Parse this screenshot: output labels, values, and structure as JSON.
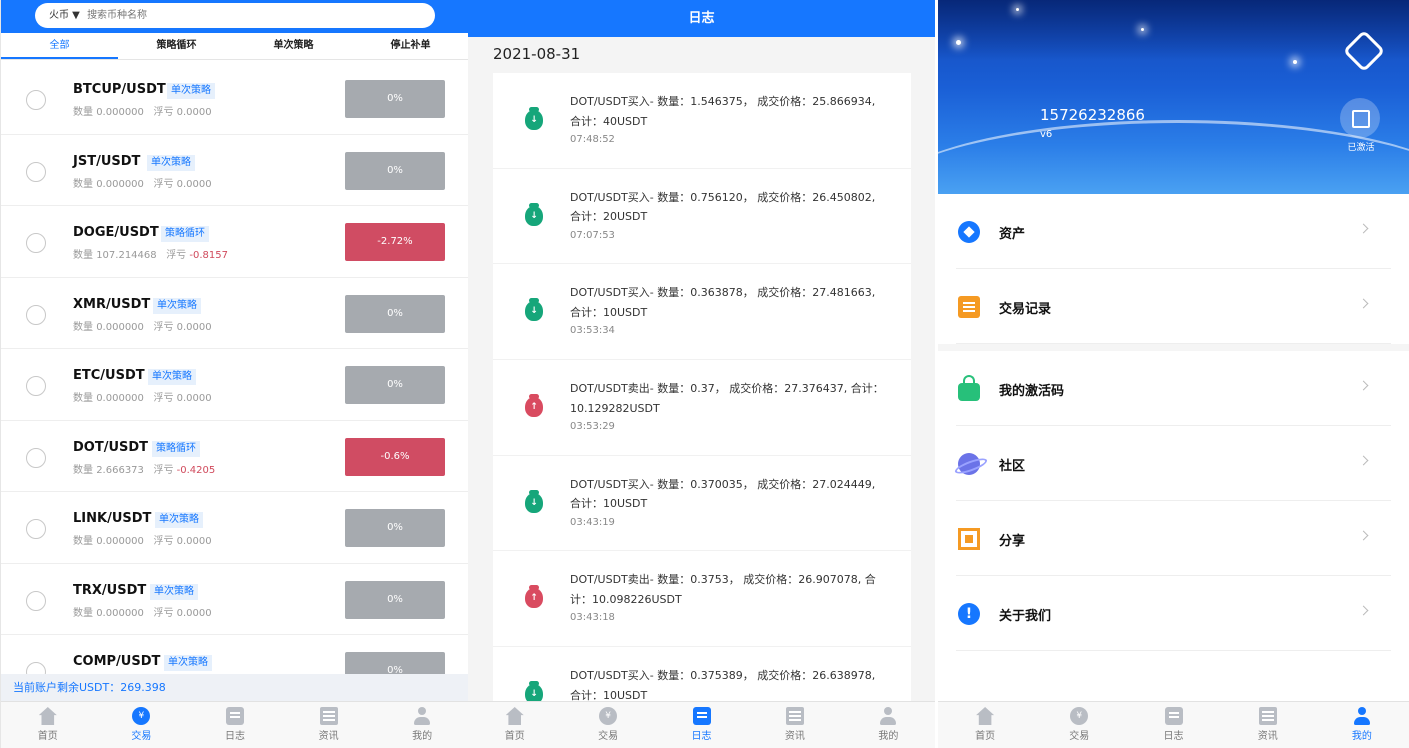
{
  "trade": {
    "search": {
      "exchange": "火币 ▼",
      "placeholder": "搜索币种名称"
    },
    "tabs": [
      "全部",
      "策略循环",
      "单次策略",
      "停止补单"
    ],
    "rows": [
      {
        "symbol": "BTCUP/USDT",
        "strategy": "单次策略",
        "qty_label": "数量",
        "qty": "0.000000",
        "pnl_label": "浮亏",
        "pnl": "0.0000",
        "pct": "0%",
        "negative": false
      },
      {
        "symbol": "JST/USDT",
        "strategy": "单次策略",
        "qty_label": "数量",
        "qty": "0.000000",
        "pnl_label": "浮亏",
        "pnl": "0.0000",
        "pct": "0%",
        "negative": false
      },
      {
        "symbol": "DOGE/USDT",
        "strategy": "策略循环",
        "qty_label": "数量",
        "qty": "107.214468",
        "pnl_label": "浮亏",
        "pnl": "-0.8157",
        "pct": "-2.72%",
        "negative": true
      },
      {
        "symbol": "XMR/USDT",
        "strategy": "单次策略",
        "qty_label": "数量",
        "qty": "0.000000",
        "pnl_label": "浮亏",
        "pnl": "0.0000",
        "pct": "0%",
        "negative": false
      },
      {
        "symbol": "ETC/USDT",
        "strategy": "单次策略",
        "qty_label": "数量",
        "qty": "0.000000",
        "pnl_label": "浮亏",
        "pnl": "0.0000",
        "pct": "0%",
        "negative": false
      },
      {
        "symbol": "DOT/USDT",
        "strategy": "策略循环",
        "qty_label": "数量",
        "qty": "2.666373",
        "pnl_label": "浮亏",
        "pnl": "-0.4205",
        "pct": "-0.6%",
        "negative": true
      },
      {
        "symbol": "LINK/USDT",
        "strategy": "单次策略",
        "qty_label": "数量",
        "qty": "0.000000",
        "pnl_label": "浮亏",
        "pnl": "0.0000",
        "pct": "0%",
        "negative": false
      },
      {
        "symbol": "TRX/USDT",
        "strategy": "单次策略",
        "qty_label": "数量",
        "qty": "0.000000",
        "pnl_label": "浮亏",
        "pnl": "0.0000",
        "pct": "0%",
        "negative": false
      },
      {
        "symbol": "COMP/USDT",
        "strategy": "单次策略",
        "qty_label": "",
        "qty": "",
        "pnl_label": "",
        "pnl": "",
        "pct": "0%",
        "negative": false
      }
    ],
    "balance": "当前账户剩余USDT：269.398"
  },
  "log": {
    "title": "日志",
    "date": "2021-08-31",
    "entries": [
      {
        "type": "buy",
        "text": "DOT/USDT买入- 数量：1.546375， 成交价格：25.866934, 合计：40USDT",
        "time": "07:48:52"
      },
      {
        "type": "buy",
        "text": "DOT/USDT买入- 数量：0.756120， 成交价格：26.450802, 合计：20USDT",
        "time": "07:07:53"
      },
      {
        "type": "buy",
        "text": "DOT/USDT买入- 数量：0.363878， 成交价格：27.481663, 合计：10USDT",
        "time": "03:53:34"
      },
      {
        "type": "sell",
        "text": "DOT/USDT卖出- 数量：0.37， 成交价格：27.376437, 合计：10.129282USDT",
        "time": "03:53:29"
      },
      {
        "type": "buy",
        "text": "DOT/USDT买入- 数量：0.370035， 成交价格：27.024449, 合计：10USDT",
        "time": "03:43:19"
      },
      {
        "type": "sell",
        "text": "DOT/USDT卖出- 数量：0.3753， 成交价格：26.907078, 合计：10.098226USDT",
        "time": "03:43:18"
      },
      {
        "type": "buy",
        "text": "DOT/USDT买入- 数量：0.375389， 成交价格：26.638978, 合计：10USDT",
        "time": ""
      }
    ]
  },
  "profile": {
    "phone": "15726232866",
    "level": "v6",
    "activated": "已激活",
    "menu_group1": [
      {
        "label": "资产",
        "icon": "asset-icon"
      },
      {
        "label": "交易记录",
        "icon": "record-icon"
      }
    ],
    "menu_group2": [
      {
        "label": "我的激活码",
        "icon": "lock-icon"
      },
      {
        "label": "社区",
        "icon": "planet-icon"
      },
      {
        "label": "分享",
        "icon": "qr-icon"
      },
      {
        "label": "关于我们",
        "icon": "info-icon"
      }
    ]
  },
  "tabbar": {
    "items": [
      "首页",
      "交易",
      "日志",
      "资讯",
      "我的"
    ],
    "active": {
      "trade": 1,
      "log": 2,
      "profile": 4
    }
  },
  "colors": {
    "primary": "#1677ff",
    "loss": "#d04c63",
    "neutral": "#a6aaaf",
    "buy": "#16a67a",
    "sell": "#d94b60"
  }
}
